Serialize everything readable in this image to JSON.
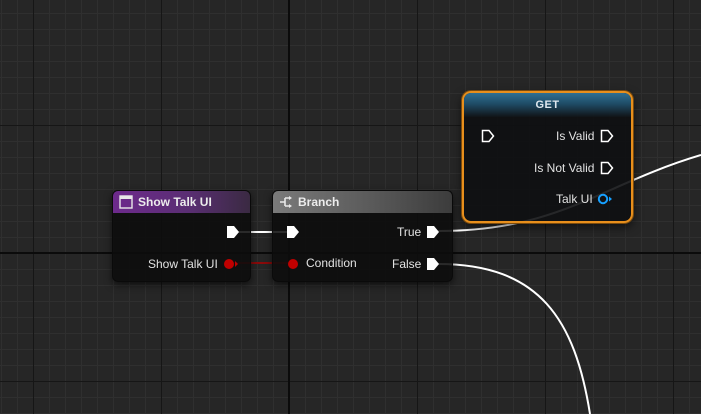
{
  "nodes": {
    "show_talk_ui": {
      "title": "Show Talk UI",
      "output_pin_label": "Show Talk UI"
    },
    "branch": {
      "title": "Branch",
      "condition_label": "Condition",
      "true_label": "True",
      "false_label": "False"
    },
    "get": {
      "title": "GET",
      "is_valid_label": "Is Valid",
      "is_not_valid_label": "Is Not Valid",
      "talk_ui_label": "Talk UI"
    }
  },
  "colors": {
    "exec_wire": "#ffffff",
    "bool_pin": "#c00000",
    "object_pin": "#16a0ff",
    "selection_outline": "#e88f1c"
  }
}
